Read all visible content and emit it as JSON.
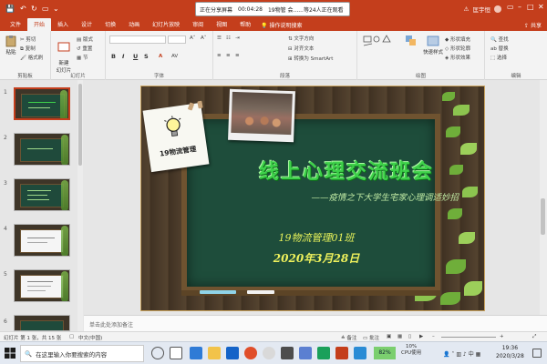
{
  "titlebar": {
    "sharing_status": "正在分享屏幕",
    "sharing_time": "00:04:28",
    "meeting_info": "19物管 会......等24人正在观看",
    "user_name": "匡宇恒",
    "accent": "#c43e1c"
  },
  "ribbon_tabs": {
    "items": [
      "文件",
      "开始",
      "插入",
      "设计",
      "切换",
      "动画",
      "幻灯片放映",
      "审阅",
      "视图",
      "帮助"
    ],
    "active_index": 1,
    "tell_me": "操作说明搜索",
    "share": "共享"
  },
  "ribbon": {
    "clipboard": {
      "paste": "粘贴",
      "cut": "剪切",
      "copy": "复制",
      "format_painter": "格式刷",
      "label": "剪贴板"
    },
    "slides": {
      "new_slide": "新建\n幻灯片",
      "layout": "版式",
      "reset": "重置",
      "section": "节",
      "label": "幻灯片"
    },
    "font": {
      "bold": "B",
      "italic": "I",
      "underline": "U",
      "strike": "S",
      "label": "字体"
    },
    "paragraph": {
      "text_direction": "文字方向",
      "align_text": "对齐文本",
      "smartart": "转换为 SmartArt",
      "label": "段落"
    },
    "drawing": {
      "fill": "形状填充",
      "outline": "形状轮廓",
      "effects": "形状效果",
      "quick_styles": "快速样式",
      "label": "绘图"
    },
    "editing": {
      "find": "查找",
      "replace": "替换",
      "select": "选择",
      "label": "编辑"
    }
  },
  "thumbnails": {
    "numbers": [
      "1",
      "2",
      "3",
      "4",
      "5",
      "6"
    ],
    "selected_index": 0
  },
  "slide": {
    "card_label": "19物流管理",
    "title": "线上心理交流班会",
    "subtitle": "——疫情之下大学生宅家心理调适妙招",
    "class_name": "19物流管理01班",
    "date": "2020年3月28日"
  },
  "notes": {
    "placeholder": "单击此处添加备注"
  },
  "statusbar": {
    "slide_count": "幻灯片 第 1 张，共 15 张",
    "language": "中文(中国)",
    "notes": "备注",
    "comments": "批注"
  },
  "taskbar": {
    "search_placeholder": "在这里输入你要搜索的内容",
    "performance": "82%",
    "cpu_percent": "10%",
    "cpu_label": "CPU使用",
    "ime": "中",
    "time": "19:36",
    "date": "2020/3/28"
  }
}
